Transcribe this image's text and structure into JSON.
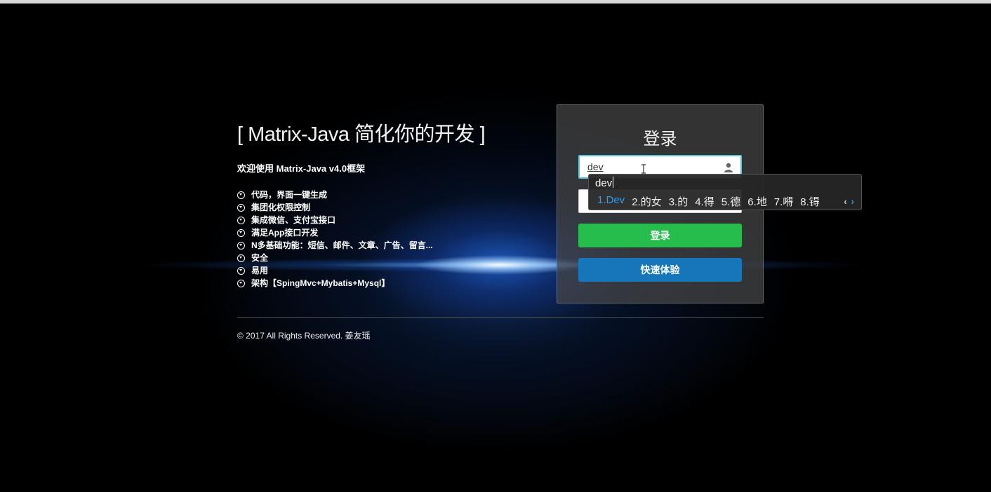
{
  "headline": "[ Matrix-Java 简化你的开发 ]",
  "welcome": "欢迎使用 Matrix-Java v4.0框架",
  "features": [
    "代码，界面一键生成",
    "集团化权限控制",
    "集成微信、支付宝接口",
    "满足App接口开发",
    "N多基础功能：短信、邮件、文章、广告、留言...",
    "安全",
    "易用",
    "架构【SpingMvc+Mybatis+Mysql】"
  ],
  "footer": "© 2017 All Rights Reserved. 姜友瑶",
  "login": {
    "title": "登录",
    "username_value": "dev",
    "login_button": "登录",
    "quick_button": "快速体验"
  },
  "ime": {
    "composition": "dev",
    "candidates": [
      "1.Dev",
      "2.的女",
      "3.的",
      "4.得",
      "5.德",
      "6.地",
      "7.嘚",
      "8.锝"
    ],
    "prev_arrow": "‹",
    "next_arrow": "›"
  },
  "colors": {
    "login_button": "#27bd4c",
    "quick_button": "#1676b9",
    "ime_active": "#2a9df4",
    "input_focus": "#55c6d8"
  }
}
